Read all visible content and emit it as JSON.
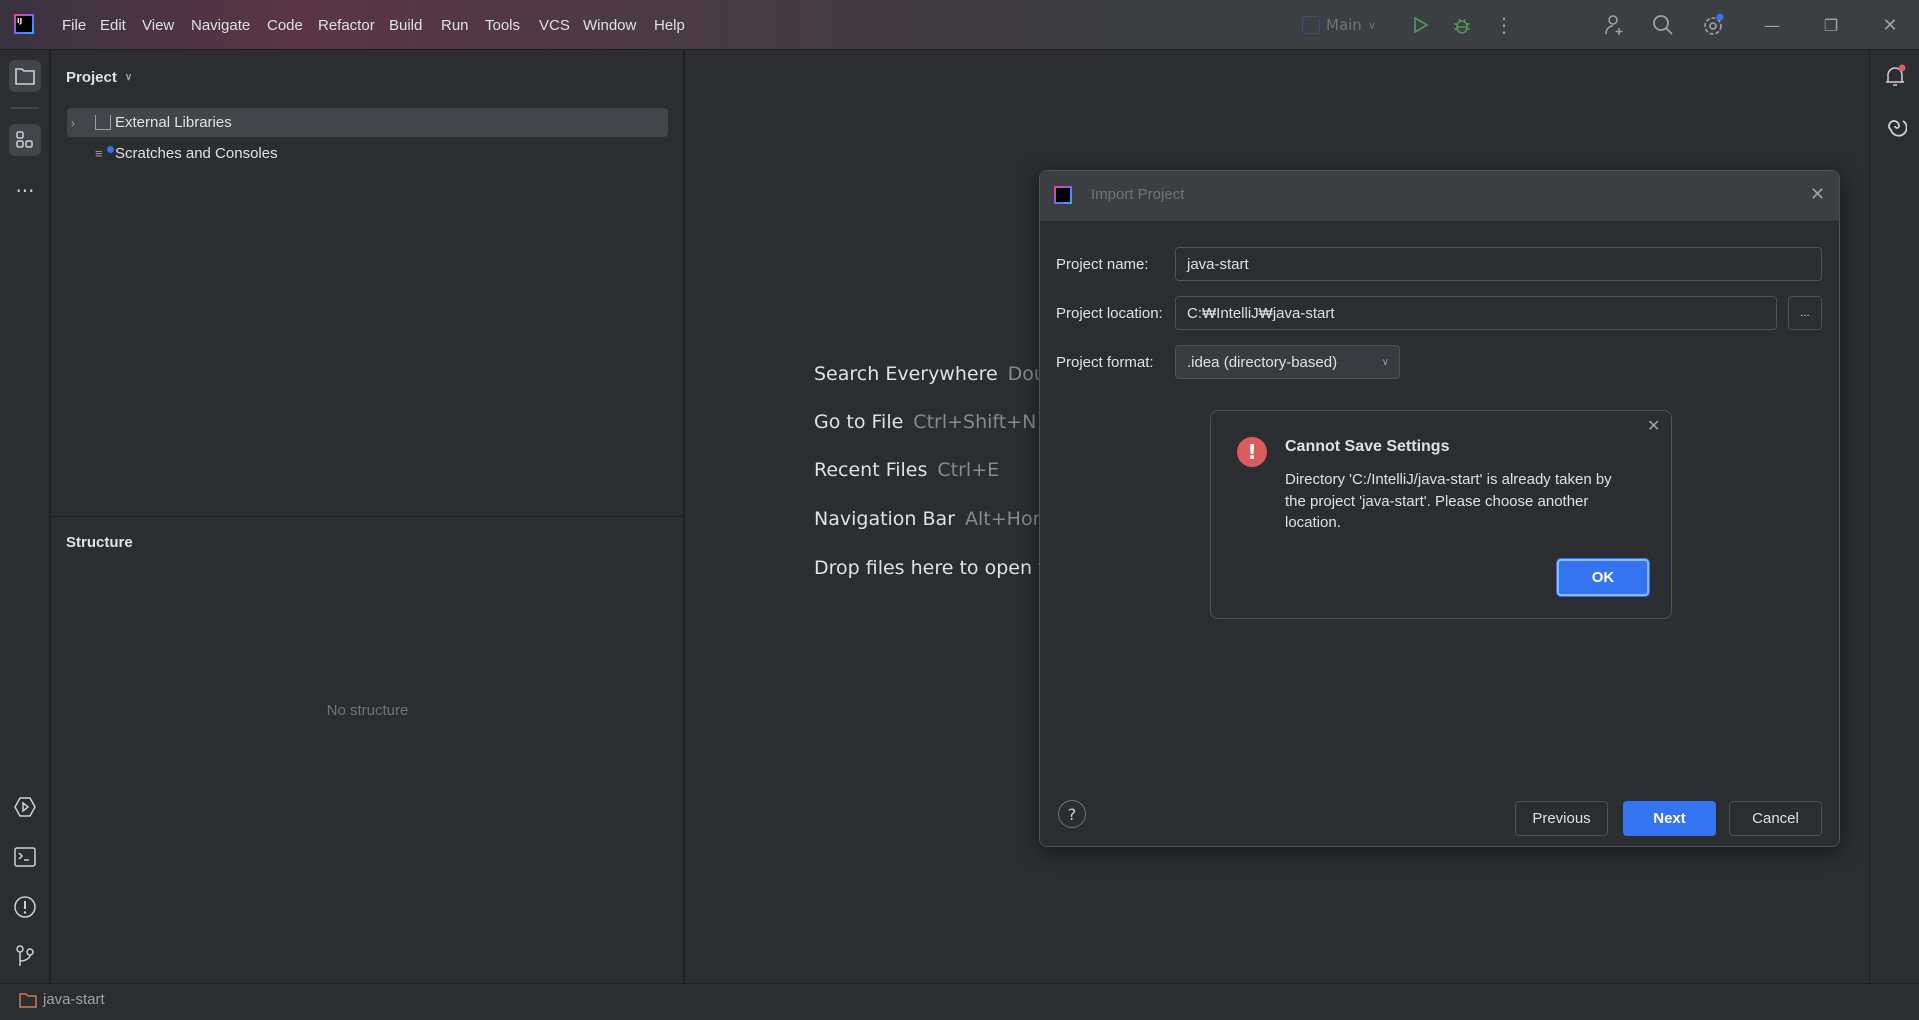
{
  "menu": [
    "File",
    "Edit",
    "View",
    "Navigate",
    "Code",
    "Refactor",
    "Build",
    "Run",
    "Tools",
    "VCS",
    "Window",
    "Help"
  ],
  "menu_mnemonic": [
    "F",
    "E",
    "V",
    "N",
    "C",
    "R",
    "B",
    "u",
    "T",
    "S",
    "W",
    "H"
  ],
  "toolbar": {
    "run_config": "Main"
  },
  "project_panel": {
    "title": "Project",
    "items": [
      {
        "label": "External Libraries",
        "icon": "library-icon",
        "selected": true
      },
      {
        "label": "Scratches and Consoles",
        "icon": "scratches-icon"
      }
    ]
  },
  "structure_panel": {
    "title": "Structure",
    "empty_text": "No structure"
  },
  "editor_hints": [
    {
      "action": "Search Everywhere",
      "shortcut": "Doul"
    },
    {
      "action": "Go to File",
      "shortcut": "Ctrl+Shift+N"
    },
    {
      "action": "Recent Files",
      "shortcut": "Ctrl+E"
    },
    {
      "action": "Navigation Bar",
      "shortcut": "Alt+Hom"
    },
    {
      "action": "Drop files here to open f",
      "shortcut": ""
    }
  ],
  "dialog": {
    "title": "Import Project",
    "name_label": "Project name:",
    "name_value": "java-start",
    "location_label": "Project location:",
    "location_value": "C:₩IntelliJ₩java-start",
    "browse_label": "...",
    "format_label": "Project format:",
    "format_value": ".idea (directory-based)",
    "previous": "Previous",
    "next": "Next",
    "cancel": "Cancel",
    "help": "?"
  },
  "alert": {
    "title": "Cannot Save Settings",
    "line1": "Directory 'C:/IntelliJ/java-start' is already taken by",
    "line2": "the project 'java-start'. Please choose another",
    "line3": "location.",
    "ok": "OK"
  },
  "status": {
    "project": "java-start"
  },
  "colors": {
    "accent": "#3574f0",
    "error": "#db5c5c",
    "run": "#57965c"
  }
}
